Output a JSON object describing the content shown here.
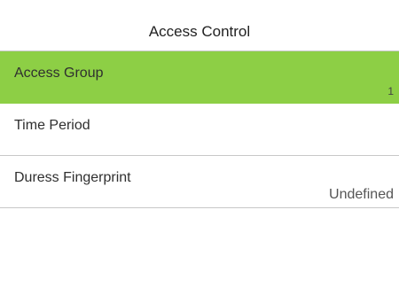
{
  "header": {
    "title": "Access Control"
  },
  "menu": {
    "items": [
      {
        "label": "Access Group",
        "value": "1",
        "selected": true
      },
      {
        "label": "Time Period",
        "value": ""
      },
      {
        "label": "Duress Fingerprint",
        "value": "Undefined"
      }
    ]
  },
  "colors": {
    "selected_background": "#8dcf45",
    "divider": "#c8c8c8"
  }
}
